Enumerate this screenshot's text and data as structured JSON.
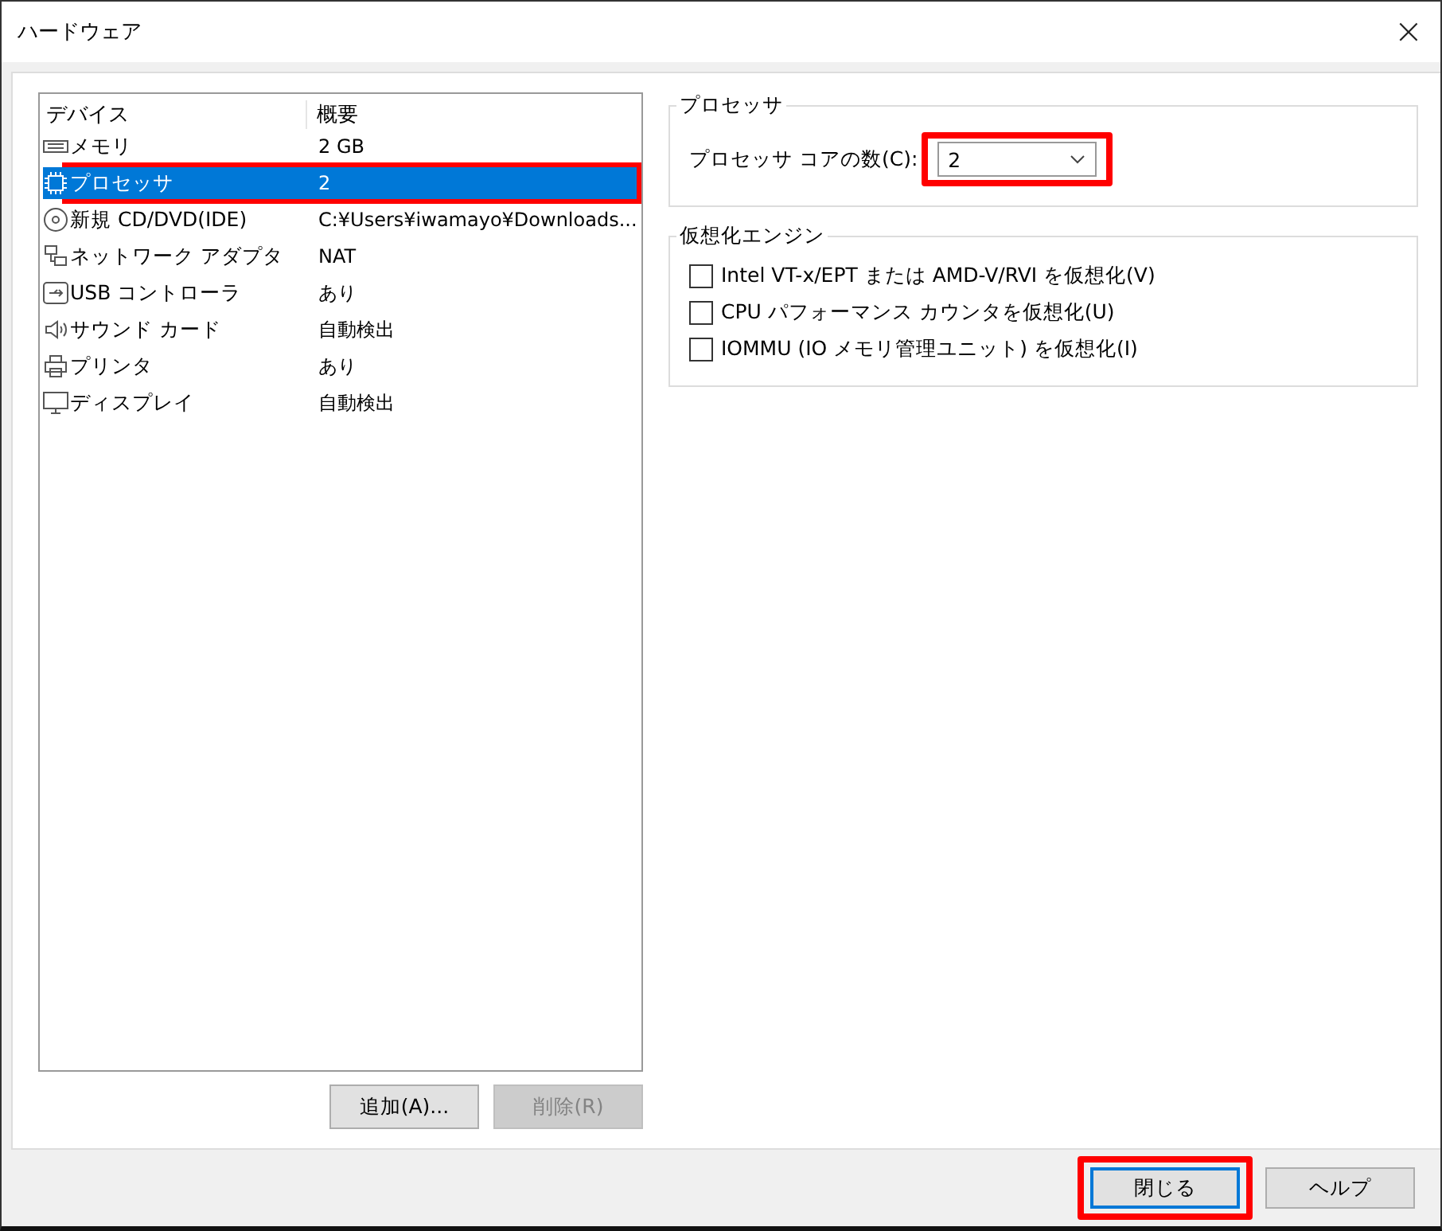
{
  "window": {
    "title": "ハードウェア",
    "close": "×"
  },
  "device_list": {
    "columns": [
      "デバイス",
      "概要"
    ],
    "rows": [
      {
        "kind": "memory",
        "name": "メモリ",
        "summary": "2 GB",
        "selected": false,
        "highlighted": false
      },
      {
        "kind": "cpu",
        "name": "プロセッサ",
        "summary": "2",
        "selected": true,
        "highlighted": true
      },
      {
        "kind": "disc",
        "name": "新規 CD/DVD(IDE)",
        "summary": "C:¥Users¥iwamayo¥Downloads...",
        "selected": false,
        "highlighted": false
      },
      {
        "kind": "network",
        "name": "ネットワーク アダプタ",
        "summary": "NAT",
        "selected": false,
        "highlighted": false
      },
      {
        "kind": "usb",
        "name": "USB コントローラ",
        "summary": "あり",
        "selected": false,
        "highlighted": false
      },
      {
        "kind": "sound",
        "name": "サウンド カード",
        "summary": "自動検出",
        "selected": false,
        "highlighted": false
      },
      {
        "kind": "printer",
        "name": "プリンタ",
        "summary": "あり",
        "selected": false,
        "highlighted": false
      },
      {
        "kind": "display",
        "name": "ディスプレイ",
        "summary": "自動検出",
        "selected": false,
        "highlighted": false
      }
    ]
  },
  "list_buttons": [
    {
      "label": "追加(A)...",
      "disabled": false
    },
    {
      "label": "削除(R)",
      "disabled": true
    }
  ],
  "processor_group": {
    "title": "プロセッサ",
    "label": "プロセッサ コアの数(C):",
    "value": "2",
    "highlighted": true
  },
  "virtualization_group": {
    "title": "仮想化エンジン",
    "options": [
      {
        "label": "Intel VT-x/EPT または AMD-V/RVI を仮想化(V)",
        "checked": false
      },
      {
        "label": "CPU パフォーマンス カウンタを仮想化(U)",
        "checked": false
      },
      {
        "label": "IOMMU (IO メモリ管理ユニット) を仮想化(I)",
        "checked": false
      }
    ]
  },
  "footer_buttons": [
    {
      "label": "閉じる",
      "default": true,
      "highlighted": true
    },
    {
      "label": "ヘルプ",
      "default": false,
      "highlighted": false
    }
  ]
}
